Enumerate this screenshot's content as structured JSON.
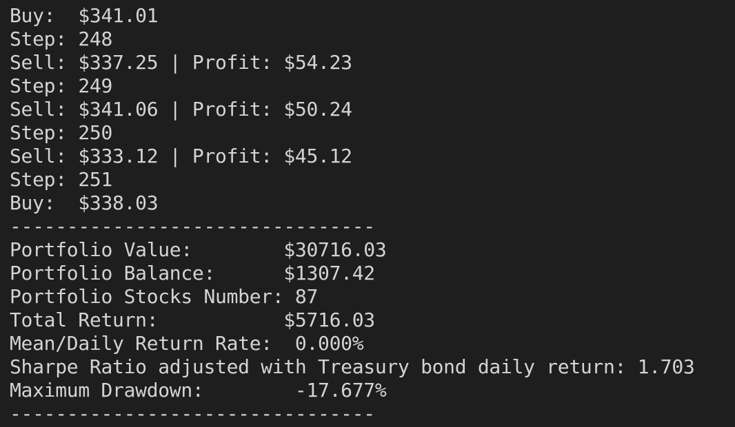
{
  "terminal": {
    "lines": [
      "Buy:  $341.01",
      "Step: 248",
      "Sell: $337.25 | Profit: $54.23",
      "Step: 249",
      "Sell: $341.06 | Profit: $50.24",
      "Step: 250",
      "Sell: $333.12 | Profit: $45.12",
      "Step: 251",
      "Buy:  $338.03",
      "--------------------------------",
      "Portfolio Value:        $30716.03",
      "Portfolio Balance:      $1307.42",
      "Portfolio Stocks Number: 87",
      "Total Return:           $5716.03",
      "Mean/Daily Return Rate:  0.000%",
      "Sharpe Ratio adjusted with Treasury bond daily return: 1.703",
      "Maximum Drawdown:        -17.677%",
      "--------------------------------"
    ]
  }
}
